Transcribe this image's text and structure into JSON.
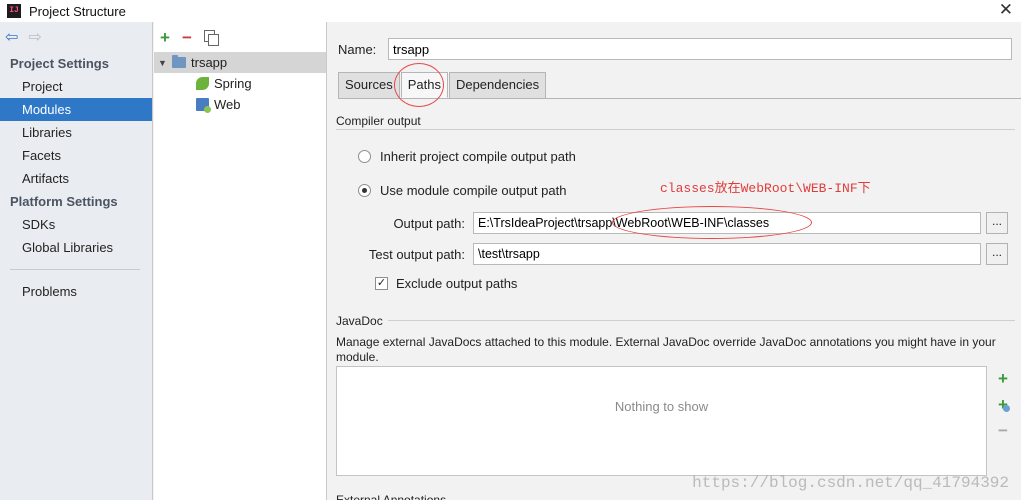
{
  "window": {
    "title": "Project Structure",
    "app_icon_text": "IJ"
  },
  "nav": {
    "project_settings_heading": "Project Settings",
    "project_settings": [
      "Project",
      "Modules",
      "Libraries",
      "Facets",
      "Artifacts"
    ],
    "platform_settings_heading": "Platform Settings",
    "platform_settings": [
      "SDKs",
      "Global Libraries"
    ],
    "other": [
      "Problems"
    ],
    "selected": "Modules"
  },
  "tree": {
    "root": "trsapp",
    "children": [
      "Spring",
      "Web"
    ]
  },
  "module": {
    "name_label": "Name:",
    "name_value": "trsapp",
    "tabs": [
      "Sources",
      "Paths",
      "Dependencies"
    ],
    "active_tab": "Paths"
  },
  "compiler": {
    "title": "Compiler output",
    "inherit_label": "Inherit project compile output path",
    "use_module_label": "Use module compile output path",
    "selected_option": "use_module",
    "output_path_label": "Output path:",
    "output_path_value": "E:\\TrsIdeaProject\\trsapp\\WebRoot\\WEB-INF\\classes",
    "test_output_label": "Test output path:",
    "test_output_value": "\\test\\trsapp",
    "browse_label": "...",
    "exclude_label": "Exclude output paths",
    "exclude_checked": true
  },
  "javadoc": {
    "title": "JavaDoc",
    "description": "Manage external JavaDocs attached to this module. External JavaDoc override JavaDoc annotations you might have in your module.",
    "empty_text": "Nothing to show"
  },
  "next_section_title": "External Annotations",
  "annotation": {
    "note": "classes放在WebRoot\\WEB-INF下"
  },
  "watermark": "https://blog.csdn.net/qq_41794392",
  "colors": {
    "selection": "#2f78c8",
    "annotation": "#e03c3c",
    "add": "#3b9b3b",
    "remove": "#d33c3c"
  }
}
